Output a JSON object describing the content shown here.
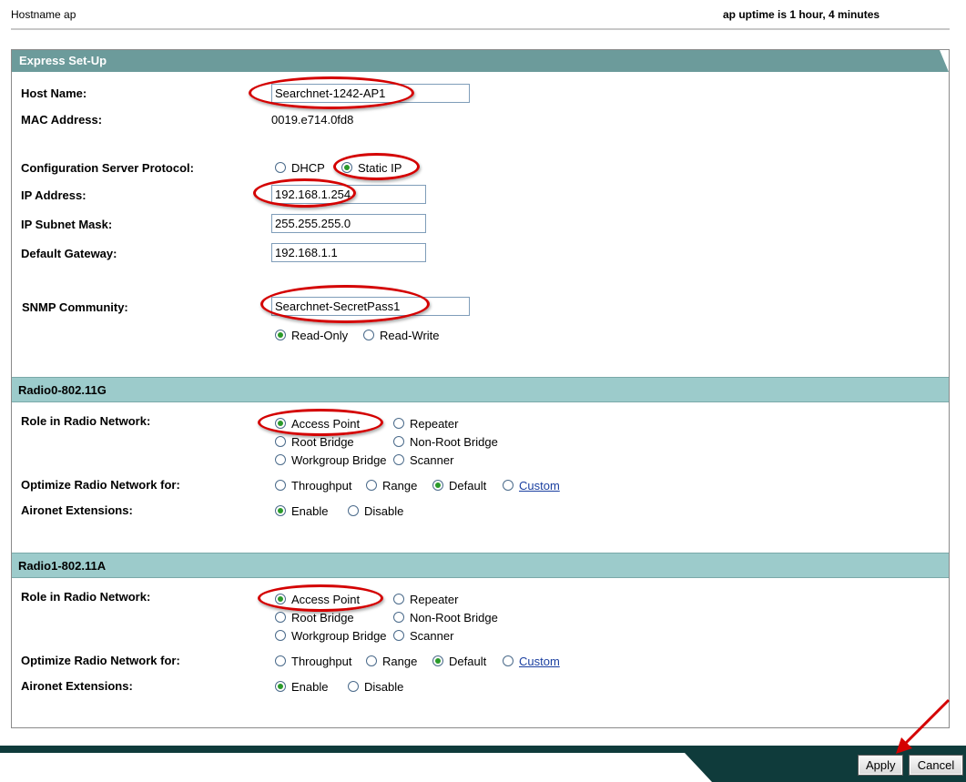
{
  "topbar": {
    "hostname": "Hostname  ap",
    "uptime": "ap uptime is 1 hour, 4 minutes"
  },
  "express": {
    "title": "Express Set-Up",
    "host_name_label": "Host Name:",
    "host_name_value": "Searchnet-1242-AP1",
    "mac_label": "MAC Address:",
    "mac_value": "0019.e714.0fd8",
    "protocol_label": "Configuration Server Protocol:",
    "protocol_options": [
      "DHCP",
      "Static IP"
    ],
    "protocol_selected": "Static IP",
    "ip_label": "IP Address:",
    "ip_value": "192.168.1.254",
    "mask_label": "IP Subnet Mask:",
    "mask_value": "255.255.255.0",
    "gateway_label": "Default Gateway:",
    "gateway_value": "192.168.1.1",
    "snmp_label": "SNMP Community:",
    "snmp_value": "Searchnet-SecretPass1",
    "snmp_access_options": [
      "Read-Only",
      "Read-Write"
    ],
    "snmp_access_selected": "Read-Only"
  },
  "radio0": {
    "title": "Radio0-802.11G",
    "role_label": "Role in Radio Network:",
    "roles": [
      "Access Point",
      "Repeater",
      "Root Bridge",
      "Non-Root Bridge",
      "Workgroup Bridge",
      "Scanner"
    ],
    "role_selected": "Access Point",
    "optimize_label": "Optimize Radio Network for:",
    "optimize_options": [
      "Throughput",
      "Range",
      "Default",
      "Custom"
    ],
    "optimize_selected": "Default",
    "aironet_label": "Aironet Extensions:",
    "aironet_options": [
      "Enable",
      "Disable"
    ],
    "aironet_selected": "Enable"
  },
  "radio1": {
    "title": "Radio1-802.11A",
    "role_label": "Role in Radio Network:",
    "roles": [
      "Access Point",
      "Repeater",
      "Root Bridge",
      "Non-Root Bridge",
      "Workgroup Bridge",
      "Scanner"
    ],
    "role_selected": "Access Point",
    "optimize_label": "Optimize Radio Network for:",
    "optimize_options": [
      "Throughput",
      "Range",
      "Default",
      "Custom"
    ],
    "optimize_selected": "Default",
    "aironet_label": "Aironet Extensions:",
    "aironet_options": [
      "Enable",
      "Disable"
    ],
    "aironet_selected": "Enable"
  },
  "buttons": {
    "apply": "Apply",
    "cancel": "Cancel"
  },
  "colors": {
    "panel_header": "#6c9b9b",
    "section_header": "#9ccbcb",
    "footer": "#0f3b3b",
    "annotation": "#d40000"
  }
}
